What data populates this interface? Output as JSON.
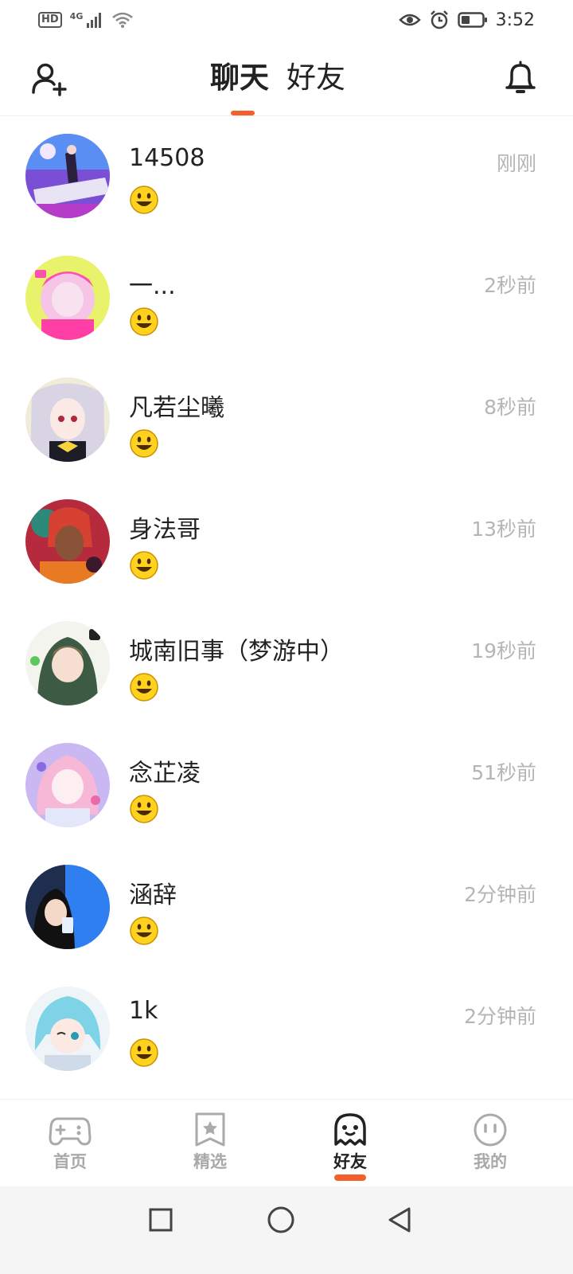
{
  "status_bar": {
    "hd_label": "HD",
    "network_label": "4G",
    "time": "3:52",
    "icons": [
      "signal-icon",
      "wifi-icon",
      "eye-icon",
      "alarm-icon",
      "battery-icon"
    ]
  },
  "header": {
    "tabs": [
      {
        "label": "聊天",
        "active": true
      },
      {
        "label": "好友",
        "active": false
      }
    ],
    "left_icon": "add-friend-icon",
    "right_icon": "bell-icon",
    "accent_color": "#f5602a"
  },
  "chats": [
    {
      "name": "14508",
      "time": "刚刚",
      "preview_icon": "smiley-emoji-icon"
    },
    {
      "name": "一...",
      "time": "2秒前",
      "preview_icon": "smiley-emoji-icon"
    },
    {
      "name": "凡若尘曦",
      "time": "8秒前",
      "preview_icon": "smiley-emoji-icon"
    },
    {
      "name": "身法哥",
      "time": "13秒前",
      "preview_icon": "smiley-emoji-icon"
    },
    {
      "name": "城南旧事（梦游中）",
      "time": "19秒前",
      "preview_icon": "smiley-emoji-icon"
    },
    {
      "name": "念芷凌",
      "time": "51秒前",
      "preview_icon": "smiley-emoji-icon"
    },
    {
      "name": "涵辞",
      "time": "2分钟前",
      "preview_icon": "smiley-emoji-icon"
    },
    {
      "name": "1k",
      "time": "2分钟前",
      "preview_icon": "smiley-emoji-icon"
    }
  ],
  "bottom_nav": [
    {
      "label": "首页",
      "icon": "gamepad-icon",
      "active": false
    },
    {
      "label": "精选",
      "icon": "star-bookmark-icon",
      "active": false
    },
    {
      "label": "好友",
      "icon": "ghost-icon",
      "active": true
    },
    {
      "label": "我的",
      "icon": "face-icon",
      "active": false
    }
  ],
  "system_nav": [
    "recents-square-icon",
    "home-circle-icon",
    "back-triangle-icon"
  ]
}
